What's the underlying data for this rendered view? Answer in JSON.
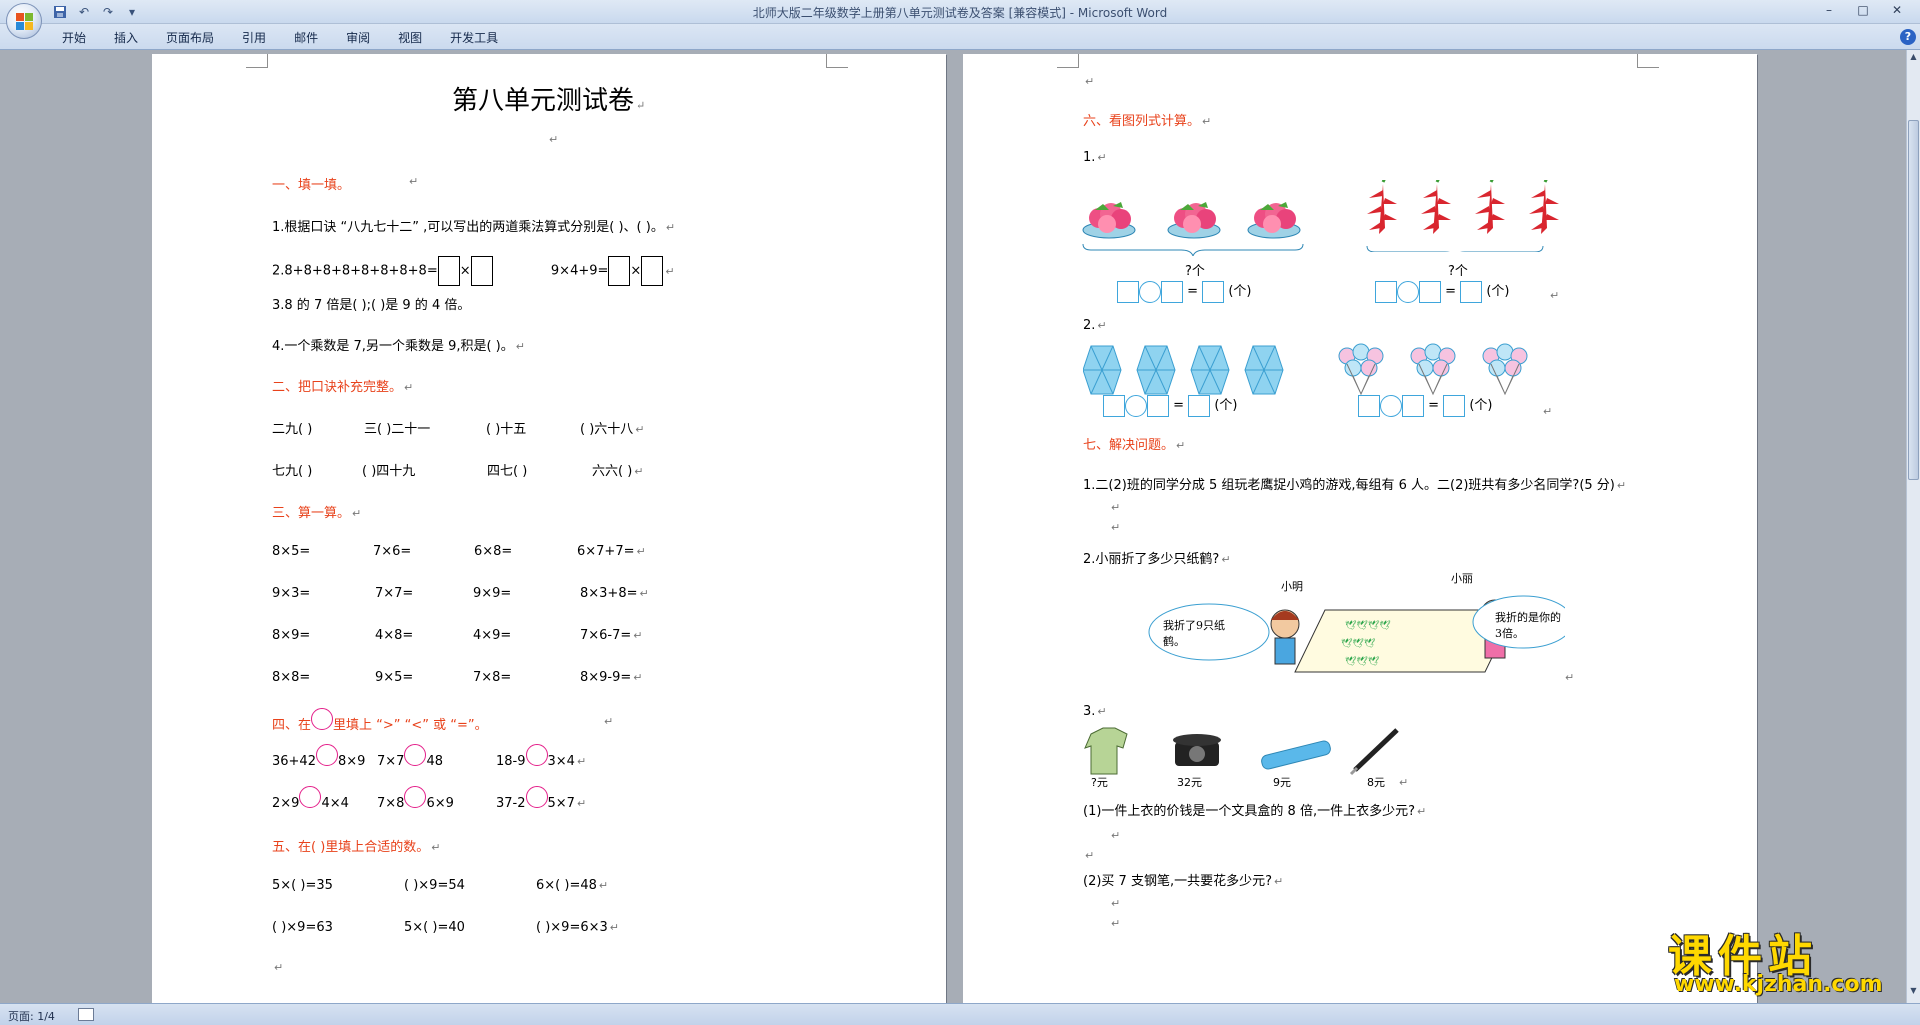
{
  "window": {
    "title": "北师大版二年级数学上册第八单元测试卷及答案 [兼容模式] - Microsoft Word",
    "controls": [
      "–",
      "□",
      "✕"
    ]
  },
  "ribbon": {
    "tabs": [
      "开始",
      "插入",
      "页面布局",
      "引用",
      "邮件",
      "审阅",
      "视图",
      "开发工具"
    ],
    "help": "?"
  },
  "status": {
    "page": "页面: 1/4"
  },
  "watermark": {
    "cn": "课件站",
    "url": "www.kjzhan.com"
  },
  "page1": {
    "title": "第八单元测试卷",
    "sec1": "一、填一填。",
    "q1": "1.根据口诀 “八九七十二” ,可以写出的两道乘法算式分别是(          )、(          )。",
    "q2a": "2.8+8+8+8+8+8+8+8=",
    "q2b": "9×4+9=",
    "q3": "3.8 的 7 倍是(       );(       )是 9 的 4 倍。",
    "q4": "4.一个乘数是 7,另一个乘数是 9,积是(       )。",
    "sec2": "二、把口诀补充完整。",
    "r2a": [
      "二九(       )",
      "三(       )二十一",
      "(       )十五",
      "(       )六十八"
    ],
    "r2b": [
      "七九(       )",
      "(       )四十九",
      "四七(       )",
      "六六(       )"
    ],
    "sec3": "三、算一算。",
    "calc": [
      [
        "8×5=",
        "7×6=",
        "6×8=",
        "6×7+7="
      ],
      [
        "9×3=",
        "7×7=",
        "9×9=",
        "8×3+8="
      ],
      [
        "8×9=",
        "4×8=",
        "4×9=",
        "7×6-7="
      ],
      [
        "8×8=",
        "9×5=",
        "7×8=",
        "8×9-9="
      ]
    ],
    "sec4a": "四、在",
    "sec4b": "里填上 “>” “<” 或 “=”。",
    "cmp1": [
      [
        "36+42",
        "8×9"
      ],
      [
        "7×7",
        "48"
      ],
      [
        "18-9",
        "3×4"
      ]
    ],
    "cmp2": [
      [
        "2×9",
        "4×4"
      ],
      [
        "7×8",
        "6×9"
      ],
      [
        "37-2",
        "5×7"
      ]
    ],
    "sec5": "五、在(       )里填上合适的数。",
    "fill1": [
      "5×(       )=35",
      "(       )×9=54",
      "6×(       )=48"
    ],
    "fill2": [
      "(       )×9=63",
      "5×(       )=40",
      "(       )×9=6×3"
    ]
  },
  "page2": {
    "sec6": "六、看图列式计算。",
    "p1": "1.",
    "q_unit": "?个",
    "eq_unit": "(个)",
    "p2": "2.",
    "sec7": "七、解决问题。",
    "q71": "1.二(2)班的同学分成 5 组玩老鹰捉小鸡的游戏,每组有 6 人。二(2)班共有多少名同学?(5 分)",
    "q72": "2.小丽折了多少只纸鹤?",
    "name_ming": "小明",
    "name_li": "小丽",
    "bubble_left": "我折了9只纸鹤。",
    "bubble_right": "我折的是你的3倍。",
    "p3": "3.",
    "prices": [
      "?元",
      "32元",
      "9元",
      "8元"
    ],
    "q73a": "(1)一件上衣的价钱是一个文具盒的 8 倍,一件上衣多少元?",
    "q73b": "(2)买 7 支钢笔,一共要花多少元?"
  },
  "colors": {
    "heading": "#e8421b",
    "circle": "#e41f8a",
    "shape_blue": "#3fa6dc"
  }
}
